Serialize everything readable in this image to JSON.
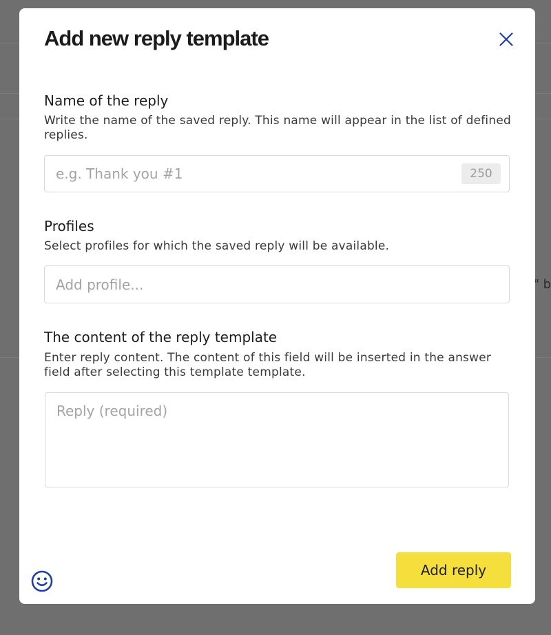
{
  "background": {
    "partial_text": "\" b"
  },
  "modal": {
    "title": "Add new reply template",
    "close_icon": "close-icon",
    "name_section": {
      "label": "Name of the reply",
      "description": "Write the name of the saved reply. This name will appear in the list of defined replies.",
      "placeholder": "e.g. Thank you #1",
      "value": "",
      "char_limit": "250"
    },
    "profiles_section": {
      "label": "Profiles",
      "description": "Select profiles for which the saved reply will be available.",
      "placeholder": "Add profile..."
    },
    "content_section": {
      "label": "The content of the reply template",
      "description": "Enter reply content. The content of this field will be inserted in the answer field after selecting this template template.",
      "placeholder": "Reply (required)"
    },
    "submit_label": "Add reply",
    "emoji_icon": "smiley-icon"
  },
  "colors": {
    "accent_button": "#f5df3c",
    "close_icon": "#1f3fa8",
    "smiley_icon": "#1f3fa8",
    "overlay": "#6f6f6f"
  }
}
